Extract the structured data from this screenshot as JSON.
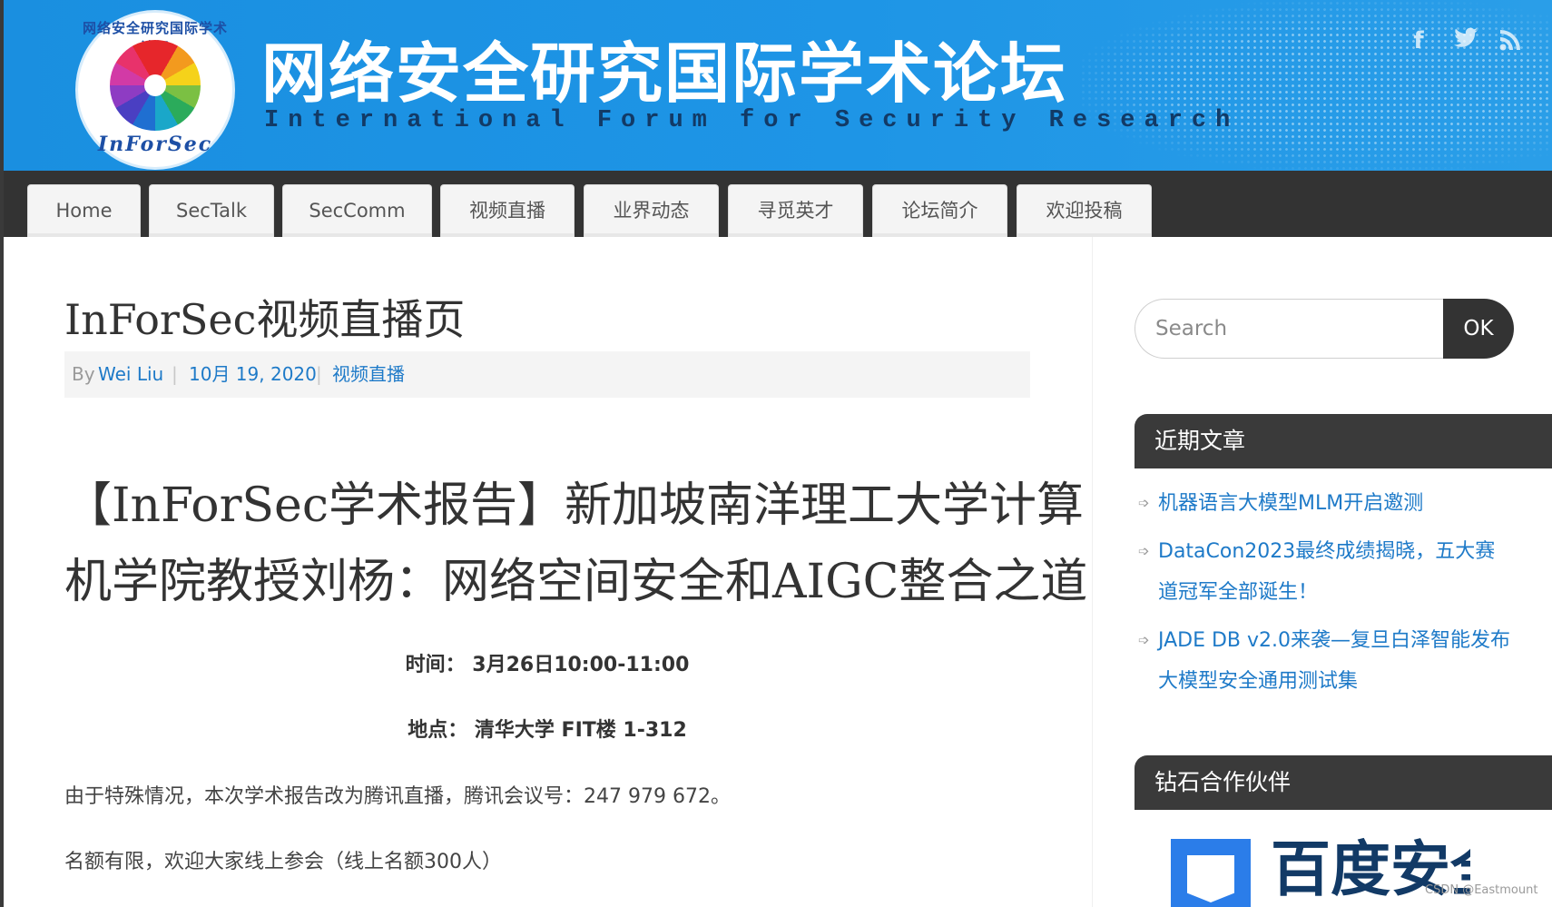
{
  "header": {
    "logo_top_text": "网络安全研究国际学术论坛",
    "logo_bottom_text": "InForSec",
    "title": "网络安全研究国际学术论坛",
    "subtitle": "International Forum for Security Research",
    "social": {
      "facebook": "f",
      "twitter": "t",
      "rss": ")"
    }
  },
  "nav": {
    "items": [
      "Home",
      "SecTalk",
      "SecComm",
      "视频直播",
      "业界动态",
      "寻觅英才",
      "论坛简介",
      "欢迎投稿"
    ]
  },
  "post": {
    "title": "InForSec视频直播页",
    "meta": {
      "by": "By",
      "author": "Wei Liu",
      "separator": "|",
      "date": "10月 19, 2020",
      "category": "视频直播"
    }
  },
  "article": {
    "title_line1": "【InForSec学术报告】新加坡南洋理工大学计算",
    "title_line2": "机学院教授刘杨：网络空间安全和AIGC整合之道",
    "time": "时间： 3月26日10:00-11:00",
    "place": "地点： 清华大学 FIT楼 1-312",
    "para1": "由于特殊情况，本次学术报告改为腾讯直播，腾讯会议号：247 979 672。",
    "para2": "名额有限，欢迎大家线上参会（线上名额300人）"
  },
  "sidebar": {
    "search": {
      "placeholder": "Search",
      "button": "OK"
    },
    "recent": {
      "title": "近期文章",
      "arrow": "➩",
      "items": [
        {
          "line1": "机器语言大模型MLM开启邀测",
          "line2": ""
        },
        {
          "line1": "DataCon2023最终成绩揭晓，五大赛",
          "line2": "道冠军全部诞生！"
        },
        {
          "line1": "JADE DB v2.0来袭—复旦白泽智能发布",
          "line2": "大模型安全通用测试集"
        }
      ]
    },
    "partners": {
      "title": "钻石合作伙伴",
      "partner_name": "百度安全"
    }
  },
  "watermark": "CSDN @Eastmount",
  "colors": {
    "banner_blue": "#1e95e6",
    "nav_dark": "#333333",
    "link_blue": "#1e7ac8"
  }
}
